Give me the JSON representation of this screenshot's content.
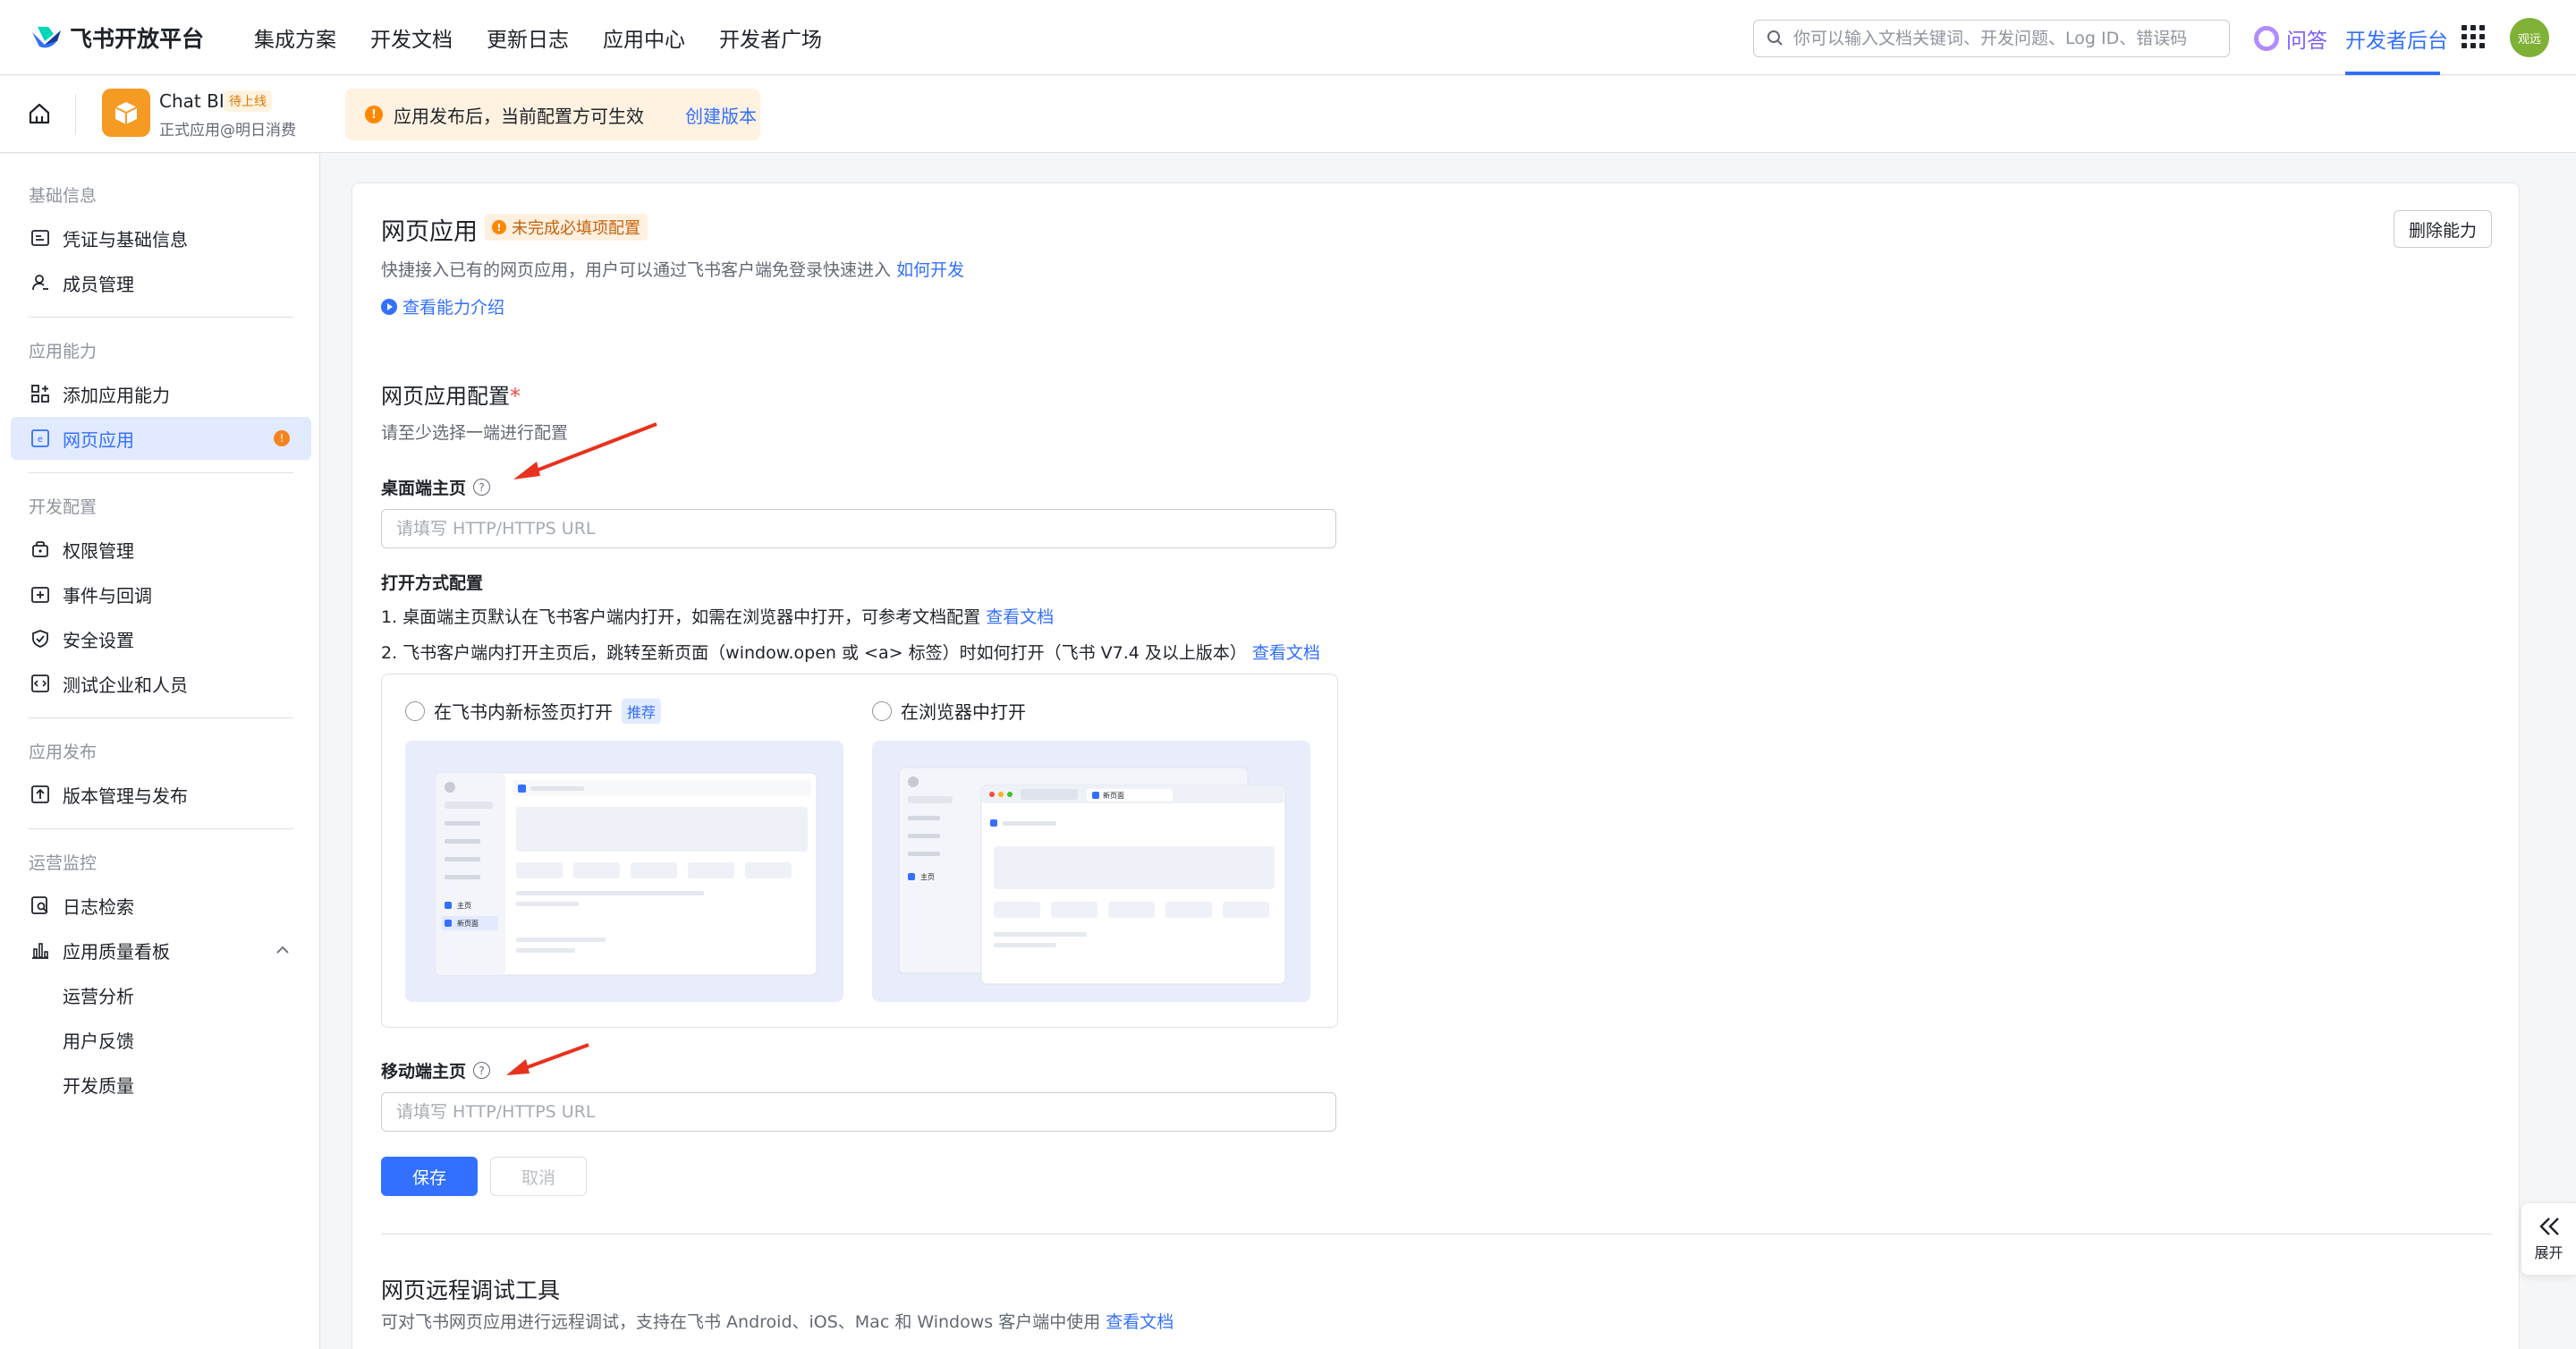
{
  "topnav": {
    "logo_text": "飞书开放平台",
    "items": [
      "集成方案",
      "开发文档",
      "更新日志",
      "应用中心",
      "开发者广场"
    ],
    "search_placeholder": "你可以输入文档关键词、开发问题、Log ID、错误码",
    "qa_label": "问答",
    "dev_console_label": "开发者后台",
    "avatar_text": "观远",
    "accent_color": "#3370ff"
  },
  "subheader": {
    "app_name": "Chat BI",
    "app_status": "待上线",
    "app_subtitle": "正式应用@明日消费",
    "notice_text": "应用发布后，当前配置方可生效",
    "notice_link": "创建版本"
  },
  "sidebar": {
    "groups": {
      "basic": "基础信息",
      "ability": "应用能力",
      "dev": "开发配置",
      "publish": "应用发布",
      "ops": "运营监控"
    },
    "items": {
      "credentials": "凭证与基础信息",
      "members": "成员管理",
      "add_ability": "添加应用能力",
      "web_app": "网页应用",
      "permissions": "权限管理",
      "events": "事件与回调",
      "security": "安全设置",
      "test_org": "测试企业和人员",
      "versions": "版本管理与发布",
      "logs": "日志检索",
      "quality": "应用质量看板",
      "ops_analysis": "运营分析",
      "feedback": "用户反馈",
      "dev_quality": "开发质量"
    },
    "web_app_badge": "!"
  },
  "main": {
    "title": "网页应用",
    "incomplete_tag": "未完成必填项配置",
    "delete_button": "删除能力",
    "description": "快捷接入已有的网页应用，用户可以通过飞书客户端免登录快速进入",
    "how_to_link": "如何开发",
    "intro_link": "查看能力介绍",
    "config_title": "网页应用配置",
    "required_mark": "*",
    "config_hint": "请至少选择一端进行配置",
    "desktop_label": "桌面端主页",
    "desktop_placeholder": "请填写 HTTP/HTTPS URL",
    "open_config_label": "打开方式配置",
    "open_note_1": "1. 桌面端主页默认在飞书客户端内打开，如需在浏览器中打开，可参考文档配置",
    "open_note_2": "2. 飞书客户端内打开主页后，跳转至新页面（window.open 或 <a> 标签）时如何打开（飞书 V7.4 及以上版本）",
    "doc_link": "查看文档",
    "option_tab": "在飞书内新标签页打开",
    "recommend_tag": "推荐",
    "option_browser": "在浏览器中打开",
    "preview_home": "主页",
    "preview_newpage": "新页面",
    "mobile_label": "移动端主页",
    "mobile_placeholder": "请填写 HTTP/HTTPS URL",
    "save_button": "保存",
    "cancel_button": "取消",
    "debug_title": "网页远程调试工具",
    "debug_desc": "可对飞书网页应用进行远程调试，支持在飞书 Android、iOS、Mac 和 Windows 客户端中使用"
  },
  "expand_label": "展开"
}
